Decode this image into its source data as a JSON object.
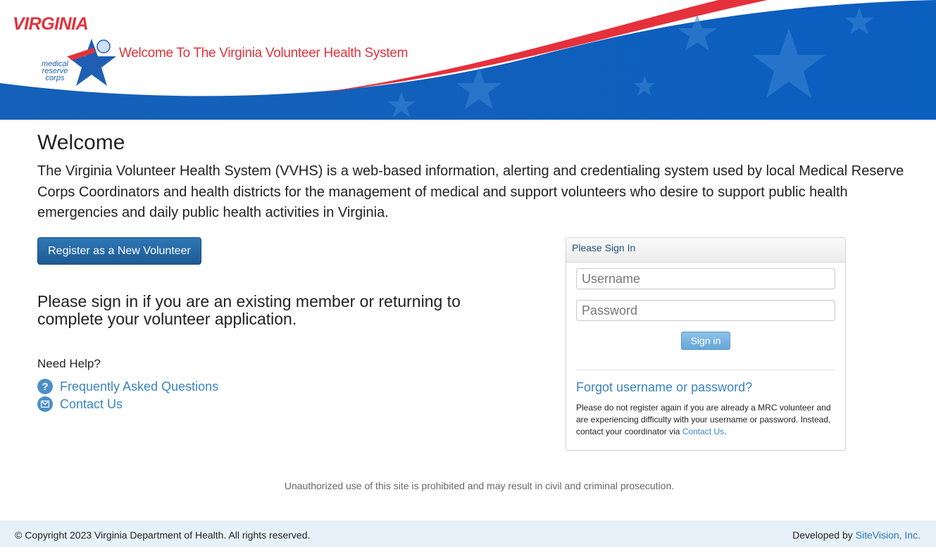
{
  "header": {
    "logo_state": "VIRGINIA",
    "logo_mrc": [
      "medical",
      "reserve",
      "corps"
    ],
    "title": "Welcome To The Virginia Volunteer Health System"
  },
  "main": {
    "welcome_title": "Welcome",
    "intro": "The Virginia Volunteer Health System (VVHS) is a web-based information, alerting and credentialing system used by local Medical Reserve Corps Coordinators and health districts for the management of medical and support volunteers who desire to support public health emergencies and daily public health activities in Virginia.",
    "register_label": "Register as a New Volunteer",
    "signin_prompt": "Please sign in if you are an existing member or returning to complete your volunteer application.",
    "help_title": "Need Help?",
    "faq_label": "Frequently Asked Questions",
    "contact_label": "Contact Us"
  },
  "signin_panel": {
    "heading": "Please Sign In",
    "username_placeholder": "Username",
    "password_placeholder": "Password",
    "signin_label": "Sign in",
    "forgot_label": "Forgot username or password?",
    "note_text": "Please do not register again if you are already a MRC volunteer and are experiencing difficulty with your username or password. Instead, contact your coordinator via",
    "note_link": "Contact Us",
    "note_end": "."
  },
  "warning": "Unauthorized use of this site is prohibited and may result in civil and criminal prosecution.",
  "footer": {
    "copyright": "© Copyright 2023 Virginia Department of Health. All rights reserved.",
    "developed_by": "Developed by",
    "developer_link": "SiteVision, Inc."
  },
  "colors": {
    "brand_red": "#e0333c",
    "brand_blue": "#1f5fb3",
    "link_blue": "#3a84c1"
  }
}
